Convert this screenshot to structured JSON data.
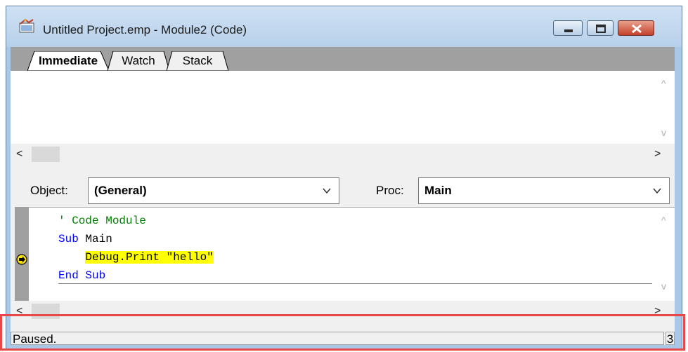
{
  "window": {
    "title": "Untitled Project.emp - Module2 (Code)"
  },
  "tabs": [
    {
      "label": "Immediate",
      "active": true
    },
    {
      "label": "Watch",
      "active": false
    },
    {
      "label": "Stack",
      "active": false
    }
  ],
  "object_selector": {
    "label": "Object:",
    "value": "(General)"
  },
  "proc_selector": {
    "label": "Proc:",
    "value": "Main"
  },
  "code": {
    "lines": [
      {
        "indent": 0,
        "parts": [
          {
            "text": "' Code Module",
            "style": "cm"
          }
        ]
      },
      {
        "indent": 0,
        "parts": [
          {
            "text": "Sub",
            "style": "kw"
          },
          {
            "text": " Main",
            "style": "plain"
          }
        ]
      },
      {
        "indent": 1,
        "parts": [
          {
            "text": "Debug.Print \"hello\"",
            "style": "hl"
          }
        ],
        "current": true
      },
      {
        "indent": 0,
        "parts": [
          {
            "text": "End Sub",
            "style": "kw"
          }
        ]
      }
    ]
  },
  "status": {
    "text": "Paused.",
    "line_number": "3"
  },
  "colors": {
    "keyword": "#0000ff",
    "comment": "#008000",
    "execution_highlight": "#ffff00",
    "status_outline": "#e84848"
  }
}
